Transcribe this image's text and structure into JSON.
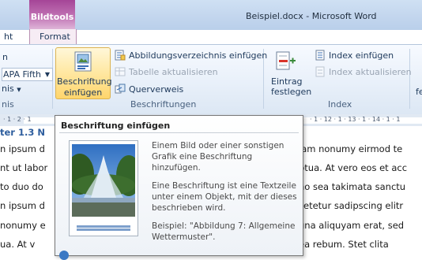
{
  "window": {
    "context_group_label": "Bildtools",
    "title": "Beispiel.docx  -  Microsoft Word"
  },
  "tabs": {
    "left_partial": "ht",
    "format": "Format"
  },
  "ribbon": {
    "left_partial": {
      "item1": "n",
      "item2": "APA Fifth",
      "item3": "nis",
      "group_label": "nis"
    },
    "captions_group": {
      "insert_caption_line1": "Beschriftung",
      "insert_caption_line2": "einfügen",
      "insert_table_of_figures": "Abbildungsverzeichnis einfügen",
      "update_table": "Tabelle aktualisieren",
      "cross_reference": "Querverweis",
      "group_label": "Beschriftungen"
    },
    "index_group": {
      "mark_entry_line1": "Eintrag",
      "mark_entry_line2": "festlegen",
      "insert_index": "Index einfügen",
      "update_index": "Index aktualisieren",
      "group_label": "Index"
    },
    "right_partial": "fe"
  },
  "ruler": {
    "left_marks": "· 1 · 2 · 1",
    "right_marks": "· 1 · 12 · 1 · 13 · 1 · 14 · 1 · 1"
  },
  "document": {
    "heading_partial": "ter 1.3 N",
    "lines_left": [
      "n ipsum d",
      "nt ut labor",
      "to duo do",
      "n ipsum d",
      "nonumy e",
      "ua.  At v"
    ],
    "lines_right": [
      "iam nonumy eirmod te",
      "ptua. At vero eos et acc",
      "no sea takimata sanctu",
      "setetur sadipscing elitr",
      "gna aliquyam erat, sed",
      "ea rebum.  Stet clita"
    ]
  },
  "tooltip": {
    "title": "Beschriftung einfügen",
    "p1": [
      "Einem Bild oder einer sonstigen",
      "Grafik eine Beschriftung",
      "hinzufügen."
    ],
    "p2": [
      "Eine Beschriftung ist eine Textzeile",
      "unter einem Objekt, mit der dieses",
      "beschrieben wird."
    ],
    "p3": [
      "Beispiel: \"Abbildung 7: Allgemeine",
      "Wettermuster\"."
    ]
  },
  "colors": {
    "context_tab": "#a54597",
    "hover_button": "#ffd56c",
    "ribbon_bg": "#e7eff9",
    "title_bg": "#c3d6ee"
  },
  "icons": {
    "caption": "picture-caption-icon",
    "table_of_figures": "table-of-figures-icon",
    "update_table": "update-table-icon",
    "cross_reference": "cross-reference-icon",
    "mark_entry": "mark-entry-icon",
    "insert_index": "insert-index-icon",
    "update_index": "update-index-icon",
    "help": "help-icon"
  }
}
